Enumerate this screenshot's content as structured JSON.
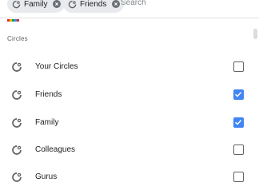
{
  "chips": [
    {
      "label": "Family",
      "icon": "circle-icon",
      "remove_icon": "close-icon"
    },
    {
      "label": "Friends",
      "icon": "circle-icon",
      "remove_icon": "close-icon"
    }
  ],
  "search": {
    "placeholder": "Search"
  },
  "section": {
    "title": "Circles"
  },
  "circles": [
    {
      "label": "Your Circles",
      "checked": false,
      "icon": "circle-icon"
    },
    {
      "label": "Friends",
      "checked": true,
      "icon": "circle-icon"
    },
    {
      "label": "Family",
      "checked": true,
      "icon": "circle-icon"
    },
    {
      "label": "Colleagues",
      "checked": false,
      "icon": "circle-icon"
    },
    {
      "label": "Gurus",
      "checked": false,
      "icon": "circle-icon"
    }
  ],
  "colors": {
    "checkbox_checked": "#4285f4",
    "chip_bg": "#e8eaed",
    "text_primary": "#202124",
    "text_secondary": "#5f6368"
  }
}
